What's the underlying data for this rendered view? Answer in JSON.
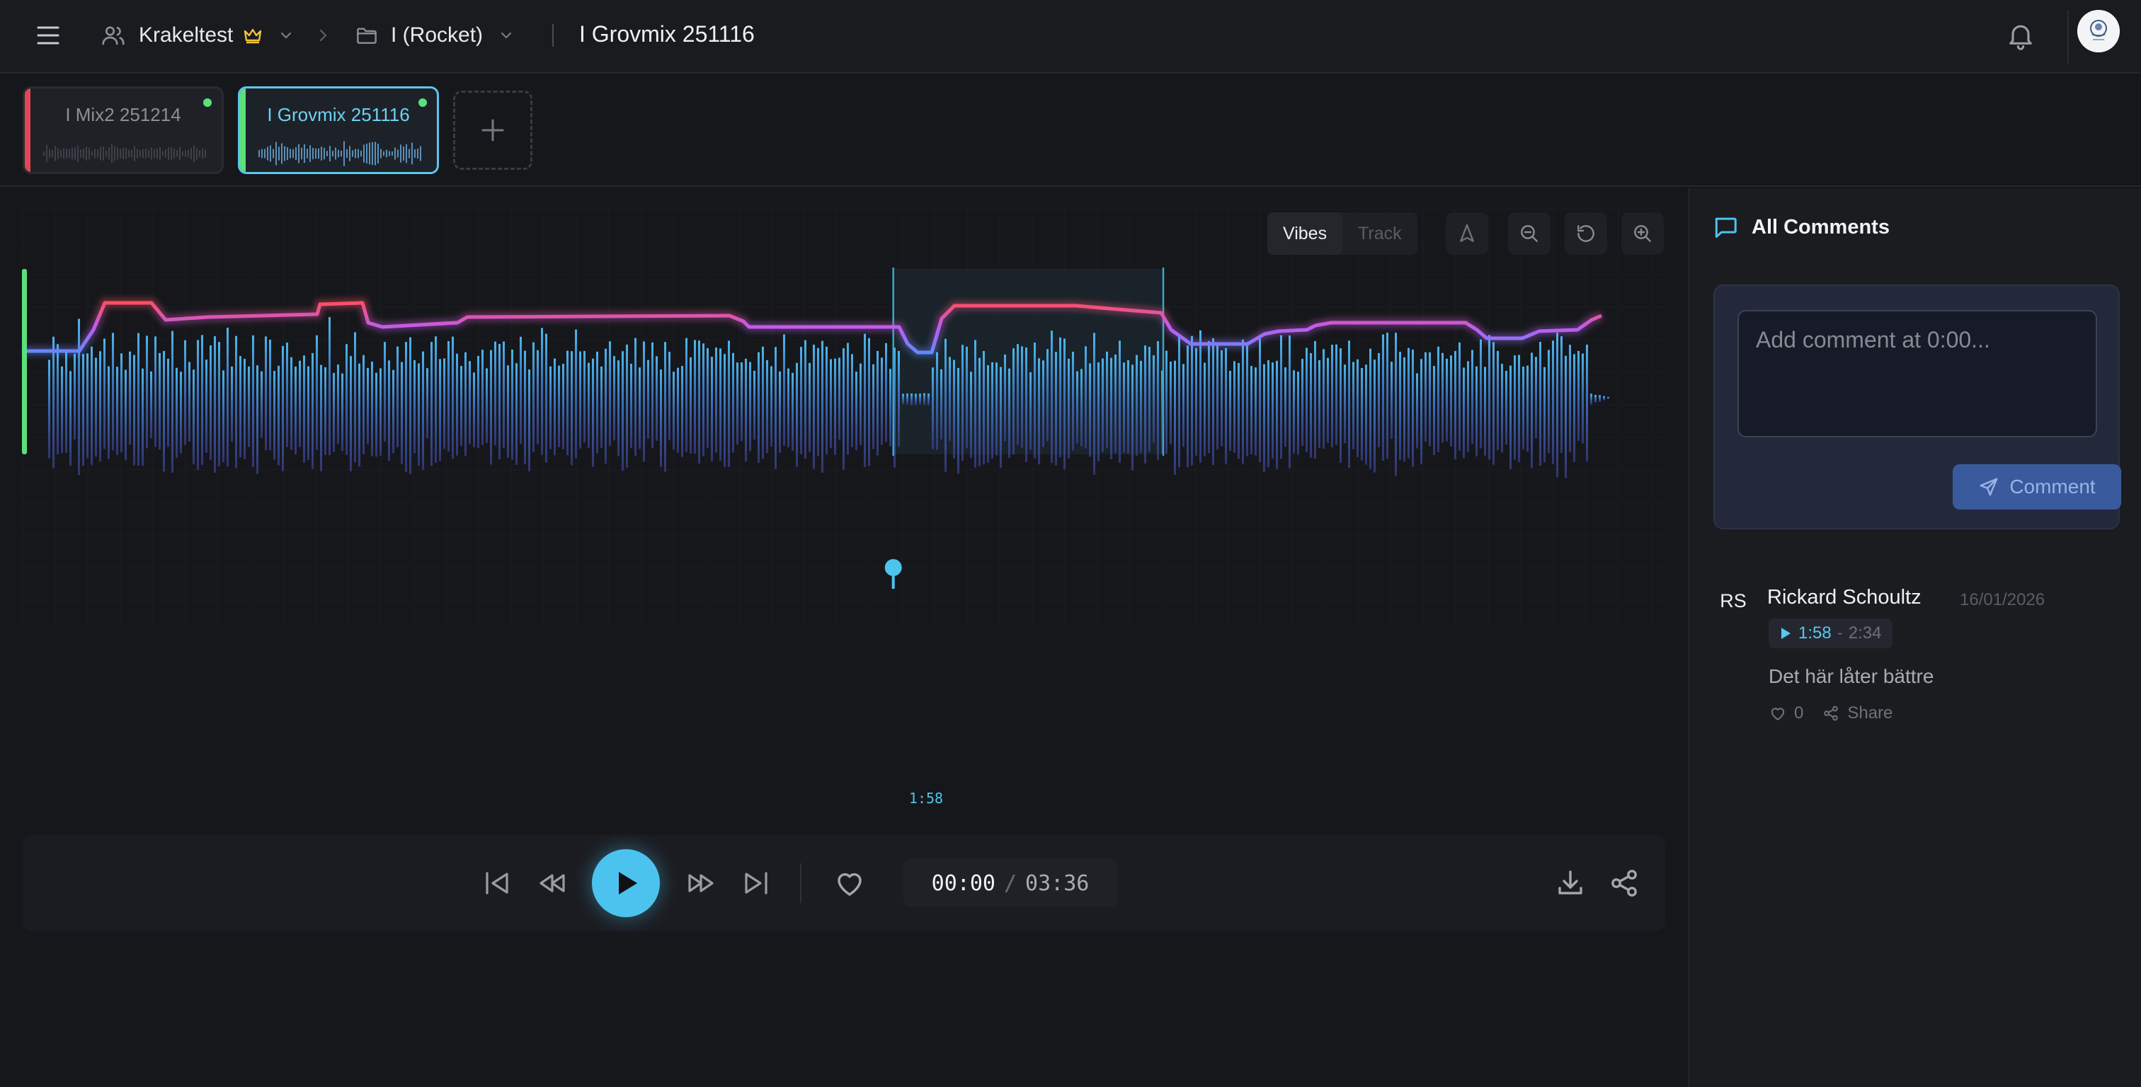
{
  "header": {
    "workspace": "Krakeltest",
    "project": "I (Rocket)",
    "title": "I Grovmix 251116"
  },
  "versions": [
    {
      "label": "I Mix2 251214",
      "stripe_color": "#e04858",
      "active": false
    },
    {
      "label": "I Grovmix 251116",
      "stripe_color": "#5be07c",
      "active": true
    }
  ],
  "waveform": {
    "modes": [
      "Vibes",
      "Track"
    ],
    "active_mode": "Vibes",
    "marker_time": "1:58",
    "region": {
      "start": "1:58",
      "end": "2:34"
    },
    "colors": {
      "bars": "#4aa8e0",
      "energy_high": "#ff4e5e",
      "energy_mid": "#c05cf0",
      "energy_low": "#5a8dff",
      "playhead": "#5be07c"
    }
  },
  "player": {
    "current_time": "00:00",
    "total_time": "03:36"
  },
  "comments_panel": {
    "title": "All Comments",
    "input_placeholder": "Add comment at 0:00...",
    "submit_label": "Comment",
    "comments": [
      {
        "initials": "RS",
        "author": "Rickard Schoultz",
        "date": "16/01/2026",
        "range_start": "1:58",
        "range_end": "2:34",
        "text": "Det här låter bättre",
        "likes": "0",
        "share_label": "Share"
      }
    ]
  }
}
